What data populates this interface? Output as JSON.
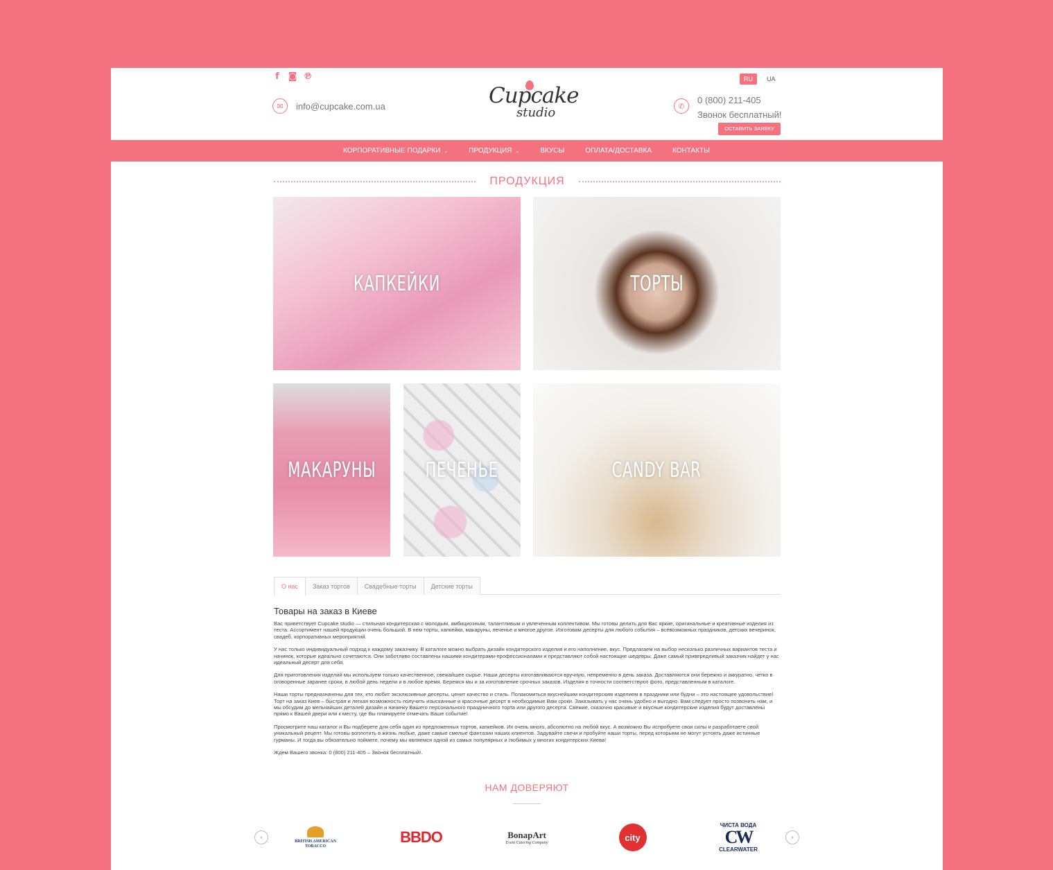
{
  "header": {
    "social": [
      {
        "name": "facebook-icon",
        "glyph": "f"
      },
      {
        "name": "instagram-icon",
        "glyph": "◙"
      },
      {
        "name": "pinterest-icon",
        "glyph": "℗"
      }
    ],
    "email": "info@cupcake.com.ua",
    "logo_top": "Cupcake",
    "logo_bottom": "studio",
    "languages": [
      "RU",
      "UA"
    ],
    "active_language": "RU",
    "phone": "0 (800) 211-405",
    "phone_note": "Звонок бесплатный!",
    "cta_label": "ОСТАВИТЬ ЗАЯВКУ"
  },
  "nav": {
    "items": [
      {
        "label": "КОРПОРАТИВНЫЕ ПОДАРКИ",
        "has_dropdown": true
      },
      {
        "label": "ПРОДУКЦИЯ",
        "has_dropdown": true
      },
      {
        "label": "ВКУСЫ",
        "has_dropdown": false
      },
      {
        "label": "ОПЛАТА/ДОСТАВКА",
        "has_dropdown": false
      },
      {
        "label": "КОНТАКТЫ",
        "has_dropdown": false
      }
    ]
  },
  "products": {
    "title": "ПРОДУКЦИЯ",
    "tiles": [
      "КАПКЕЙКИ",
      "ТОРТЫ",
      "МАКАРУНЫ",
      "ПЕЧЕНЬЕ",
      "CANDY BAR"
    ]
  },
  "tabs": [
    "О нас",
    "Заказ тортов",
    "Свадебные торты",
    "Детские торты"
  ],
  "active_tab": "О нас",
  "article": {
    "heading": "Товары на заказ в Киеве",
    "paragraphs": [
      "Вас приветствует Cupcake studio — стильная кондитерская с молодым, амбициозным, талантливым и увлеченным коллективом. Мы готовы делать для Вас яркие, оригинальные и креативные изделия из теста. Ассортимент нашей продукции очень большой. В нем торты, капкейки, макаруны, печенье и многое другое. Изготовим десерты для любого события – всевозможных праздников, детских вечеринок, свадеб, корпоративных мероприятий.",
      "У нас только индивидуальный подход к каждому заказчику. В каталоге можно выбрать дизайн кондитерского изделия и его наполнение, вкус. Предлагаем на выбор несколько различных вариантов теста и начинок, которые идеально сочетаются. Они заботливо составлены нашими кондитерами-профессионалами и представляют собой настоящие шедевры. Даже самый привередливый заказчик найдет у нас идеальный десерт для себя.",
      "Для приготовления изделий мы используем только качественное, свежайшее сырье. Наши десерты изготавливаются вручную, непременно в день заказа. Доставляются они бережно и аккуратно, четко в оговоренные заранее сроки, в любой день недели и в любое время. Беремся мы и за изготовление срочных заказов. Изделия в точности соответствуют фото, представленным в каталоге.",
      "Наши торты предназначены для тех, кто любит эксклюзивные десерты, ценит качество и стиль. Полакомиться вкуснейшим кондитерским изделием в праздники или будни – это настоящее удовольствие! Торт на заказ Киев – быстрая и легкая возможность получить изысканные и красочные десерт в необходимые Вам сроки. Заказывать у нас очень удобно и выгодно. Вам следует просто позвонить нам, и мы обсудим до мельчайших деталей дизайн и начинку Вашего персонального праздничного торта или другого десерта. Свежие, сказочно красивые и вкусные кондитерские изделия будут доставлены прямо к Вашей двери или к месту, где Вы планируете отмечать Ваше событие!",
      "Просмотрите наш каталог и Вы подберете для себя один из предложенных тортов, капкейков. Их очень много, абсолютно на любой вкус. А возможно Вы испробуете свои силы и разработаете свой уникальный рецепт. Мы готовы воплотить в жизнь любые, даже самые смелые фантазии наших клиентов. Задувайте свечи и пробуйте наши торты, перед которыми не могут устоять даже истинные гурманы. И тогда вы обязательно поймете, почему мы являемся одной из самых популярных и любимых у многих кондитерских Киева!",
      "Ждем Вашего звонка: 0 (800) 211-405 – Звонок бесплатный!."
    ]
  },
  "trust": {
    "title": "НАМ ДОВЕРЯЮТ",
    "bat": [
      "BRITISH AMERICAN",
      "TOBACCO"
    ],
    "bbdo": "BBDO",
    "bonap": [
      "BonapArt",
      "Event Catering Company"
    ],
    "city": "city",
    "cw": [
      "ЧИСТА ВОДА",
      "CW",
      "CLEARWATER"
    ]
  },
  "colors": {
    "accent": "#f4727f",
    "background": "#f4727f"
  }
}
